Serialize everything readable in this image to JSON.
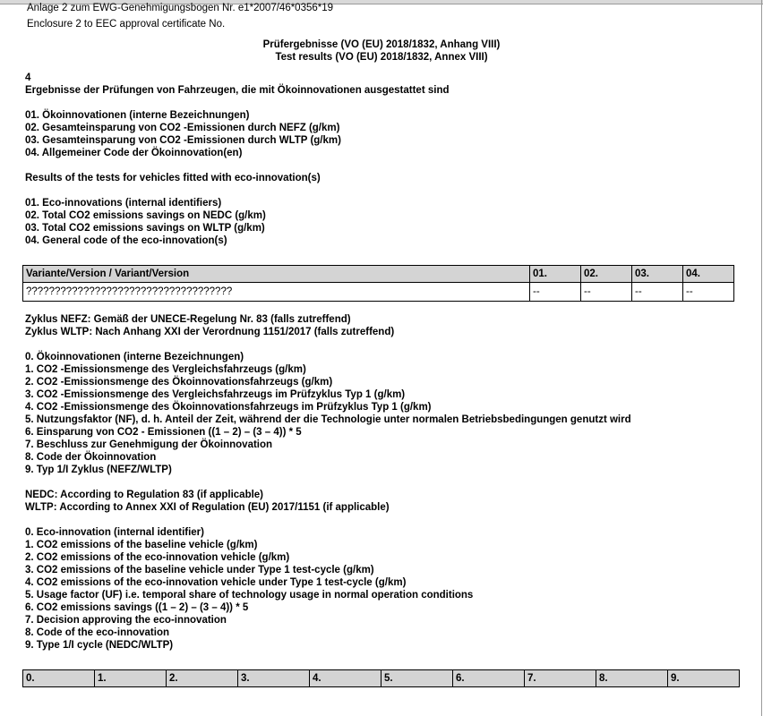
{
  "header": {
    "line1": "Anlage 2 zum EWG-Genehmigungsbogen Nr. e1*2007/46*0356*19",
    "line2": "Enclosure 2 to EEC approval certificate No."
  },
  "title": {
    "de": "Prüfergebnisse (VO (EU) 2018/1832, Anhang VIII)",
    "en": "Test results (VO (EU) 2018/1832, Annex VIII)"
  },
  "section_de": {
    "number": "4",
    "heading": "Ergebnisse der Prüfungen von Fahrzeugen, die mit Ökoinnovationen ausgestattet sind",
    "items": [
      "01. Ökoinnovationen (interne Bezeichnungen)",
      "02. Gesamteinsparung von CO2 -Emissionen durch NEFZ (g/km)",
      "03. Gesamteinsparung von CO2 -Emissionen durch WLTP (g/km)",
      "04. Allgemeiner Code der Ökoinnovation(en)"
    ]
  },
  "section_en": {
    "heading": "Results of the tests for vehicles fitted with eco-innovation(s)",
    "items": [
      "01. Eco-innovations (internal identifiers)",
      "02. Total CO2 emissions savings on NEDC (g/km)",
      "03. Total CO2 emissions savings on WLTP (g/km)",
      "04. General code of the eco-innovation(s)"
    ]
  },
  "variant_table": {
    "headers": [
      "Variante/Version / Variant/Version",
      "01.",
      "02.",
      "03.",
      "04."
    ],
    "row": [
      "????????????????????????????????????",
      "--",
      "--",
      "--",
      "--"
    ]
  },
  "cycle_de": {
    "lines": [
      "Zyklus NEFZ: Gemäß der UNECE-Regelung Nr. 83 (falls zutreffend)",
      "Zyklus WLTP: Nach Anhang XXI der Verordnung 1151/2017 (falls zutreffend)"
    ],
    "items": [
      "0. Ökoinnovationen (interne Bezeichnungen)",
      "1. CO2 -Emissionsmenge des Vergleichsfahrzeugs (g/km)",
      "2. CO2 -Emissionsmenge des Ökoinnovationsfahrzeugs (g/km)",
      "3. CO2 -Emissionsmenge des Vergleichsfahrzeugs im Prüfzyklus Typ 1 (g/km)",
      "4. CO2 -Emissionsmenge des Ökoinnovationsfahrzeugs im Prüfzyklus Typ 1 (g/km)",
      "5. Nutzungsfaktor (NF), d. h. Anteil der Zeit, während der die Technologie unter normalen Betriebsbedingungen genutzt wird",
      "6. Einsparung von CO2 - Emissionen ((1 – 2) – (3 – 4)) * 5",
      "7. Beschluss zur Genehmigung der Ökoinnovation",
      "8. Code der Ökoinnovation",
      "9. Typ 1/I Zyklus (NEFZ/WLTP)"
    ]
  },
  "cycle_en": {
    "lines": [
      "NEDC: According to Regulation 83 (if applicable)",
      "WLTP: According to Annex XXI of Regulation (EU) 2017/1151 (if applicable)"
    ],
    "items": [
      "0. Eco-innovation (internal identifier)",
      "1. CO2 emissions of the baseline vehicle (g/km)",
      "2. CO2 emissions of the eco-innovation vehicle (g/km)",
      "3. CO2 emissions of the baseline vehicle under Type 1 test-cycle (g/km)",
      "4. CO2 emissions of the eco-innovation vehicle under Type 1 test-cycle (g/km)",
      "5. Usage factor (UF) i.e. temporal share of technology usage in normal operation conditions",
      "6. CO2 emissions savings ((1 – 2) – (3 – 4)) * 5",
      "7. Decision approving the eco-innovation",
      "8. Code of the eco-innovation",
      "9. Type 1/I cycle (NEDC/WLTP)"
    ]
  },
  "bottom_table": {
    "headers": [
      "0.",
      "1.",
      "2.",
      "3.",
      "4.",
      "5.",
      "6.",
      "7.",
      "8.",
      "9."
    ]
  }
}
